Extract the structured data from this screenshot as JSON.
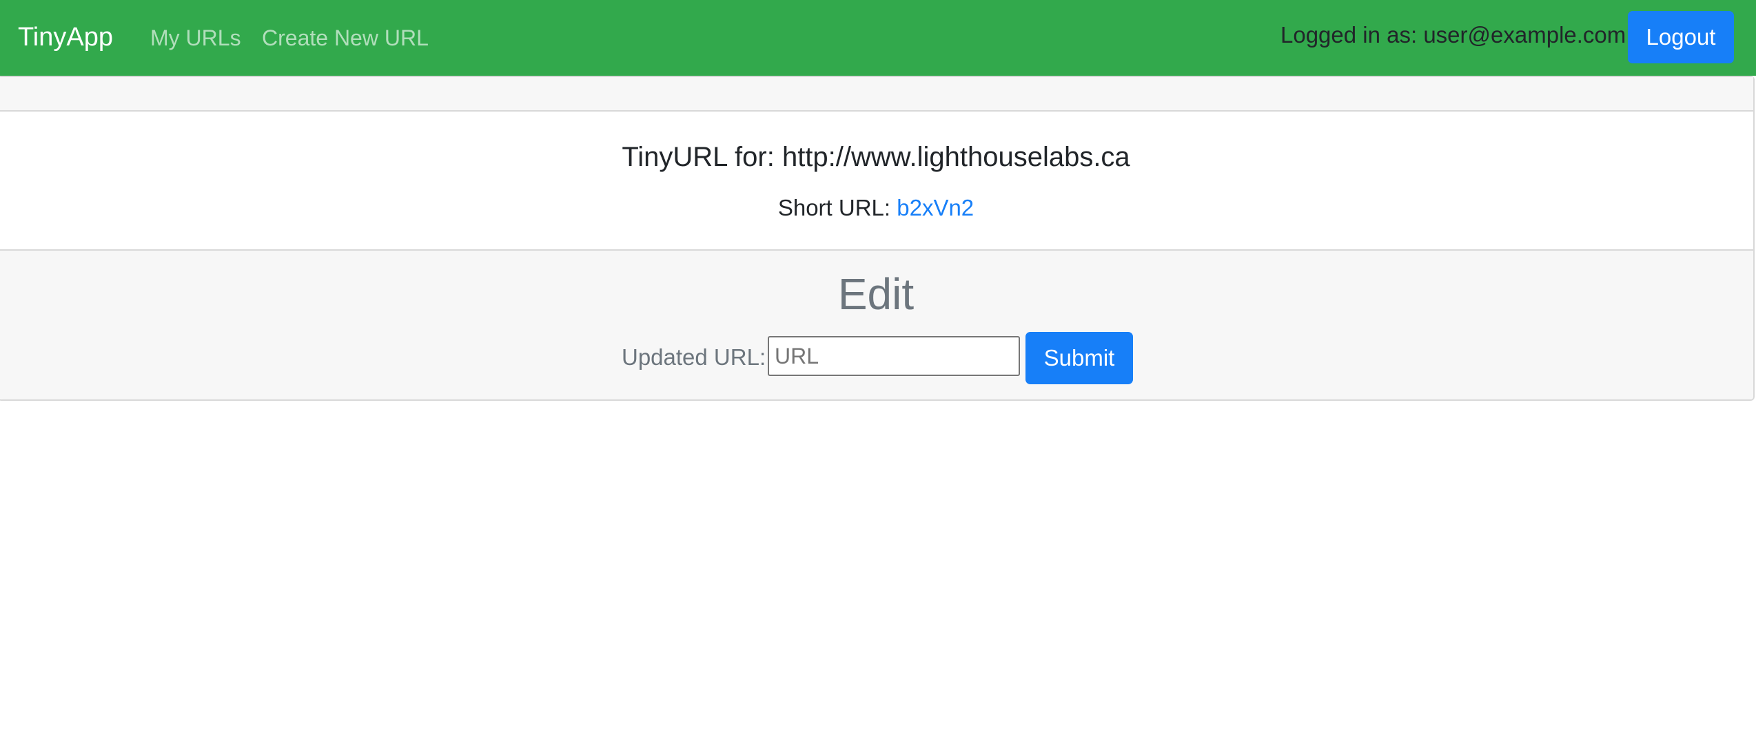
{
  "navbar": {
    "brand": "TinyApp",
    "links": [
      {
        "label": "My URLs"
      },
      {
        "label": "Create New URL"
      }
    ],
    "logged_in_text": "Logged in as: user@example.com!",
    "logout_label": "Logout",
    "background_color": "#32a94c"
  },
  "card": {
    "title": "TinyURL for: http://www.lighthouselabs.ca",
    "short_url_label": "Short URL:",
    "short_url_value": "b2xVn2",
    "edit": {
      "heading": "Edit",
      "field_label": "Updated URL:",
      "input_value": "",
      "input_placeholder": "URL",
      "submit_label": "Submit"
    }
  },
  "colors": {
    "primary": "#177ff8",
    "muted": "#6c757d"
  }
}
